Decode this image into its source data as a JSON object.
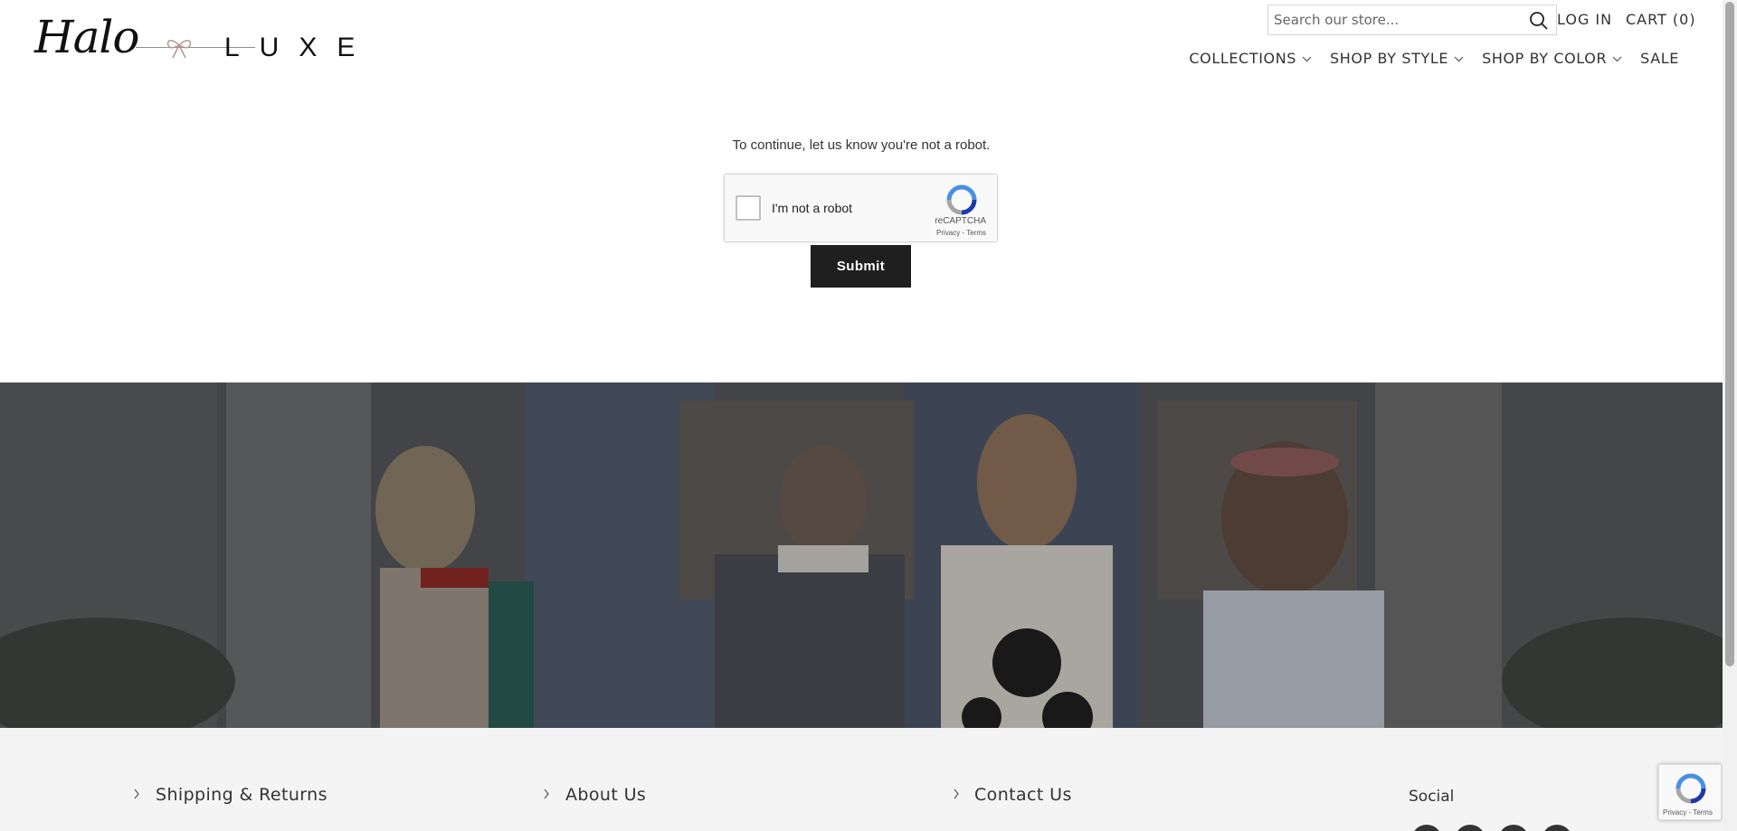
{
  "brand": {
    "script": "Halo",
    "word": "LUXE"
  },
  "search": {
    "placeholder": "Search our store..."
  },
  "header": {
    "login": "LOG IN",
    "cart": "CART (0)"
  },
  "nav": [
    {
      "label": "COLLECTIONS",
      "dropdown": true
    },
    {
      "label": "SHOP BY STYLE",
      "dropdown": true
    },
    {
      "label": "SHOP BY COLOR",
      "dropdown": true
    },
    {
      "label": "SALE",
      "dropdown": false
    }
  ],
  "captcha": {
    "prompt": "To continue, let us know you're not a robot.",
    "label": "I'm not a robot",
    "brand": "reCAPTCHA",
    "links": "Privacy - Terms",
    "submit": "Submit"
  },
  "footer": {
    "col1": "Shipping & Returns",
    "col2": "About Us",
    "col3": "Contact Us",
    "social_title": "Social"
  },
  "badge": {
    "links": "Privacy - Terms"
  },
  "colors": {
    "dark": "#1f1f1f",
    "banner_overlay": "#4a4a4c",
    "footer_bg": "#f4f4f4",
    "recaptcha_blue": "#4a90e2"
  }
}
